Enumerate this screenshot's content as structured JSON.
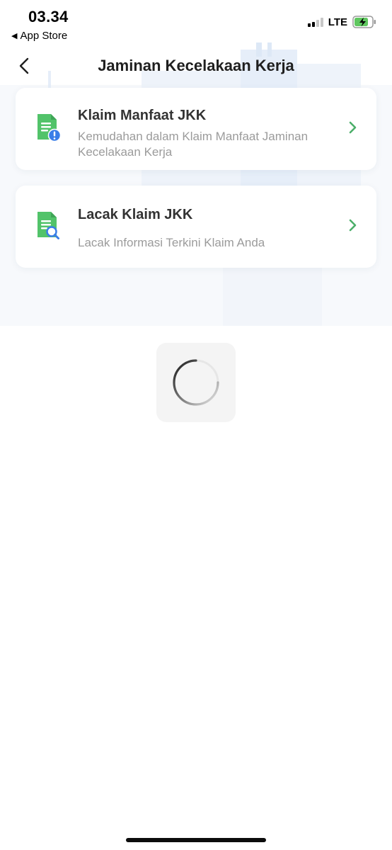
{
  "status_bar": {
    "time": "03.34",
    "back_app": "App Store",
    "network": "LTE",
    "signal_bars_active": 2,
    "signal_bars_total": 4,
    "battery_charging": true,
    "battery_level": 0.7
  },
  "nav": {
    "title": "Jaminan Kecelakaan Kerja",
    "back_icon": "chevron-left-icon"
  },
  "menu": [
    {
      "title": "Klaim Manfaat JKK",
      "description": "Kemudahan dalam Klaim Manfaat Jaminan Kecelakaan Kerja",
      "icon": "document-alert-icon"
    },
    {
      "title": "Lacak Klaim JKK",
      "description": "Lacak Informasi Terkini Klaim Anda",
      "icon": "document-search-icon"
    }
  ],
  "loading": {
    "visible": true,
    "icon": "spinner-icon"
  },
  "colors": {
    "accent_green": "#5cc073",
    "icon_green": "#52c36a",
    "icon_blue": "#3a7ee8",
    "chevron_green": "#4caf6a",
    "title_text": "#333333",
    "desc_text": "#9b9b9b"
  }
}
